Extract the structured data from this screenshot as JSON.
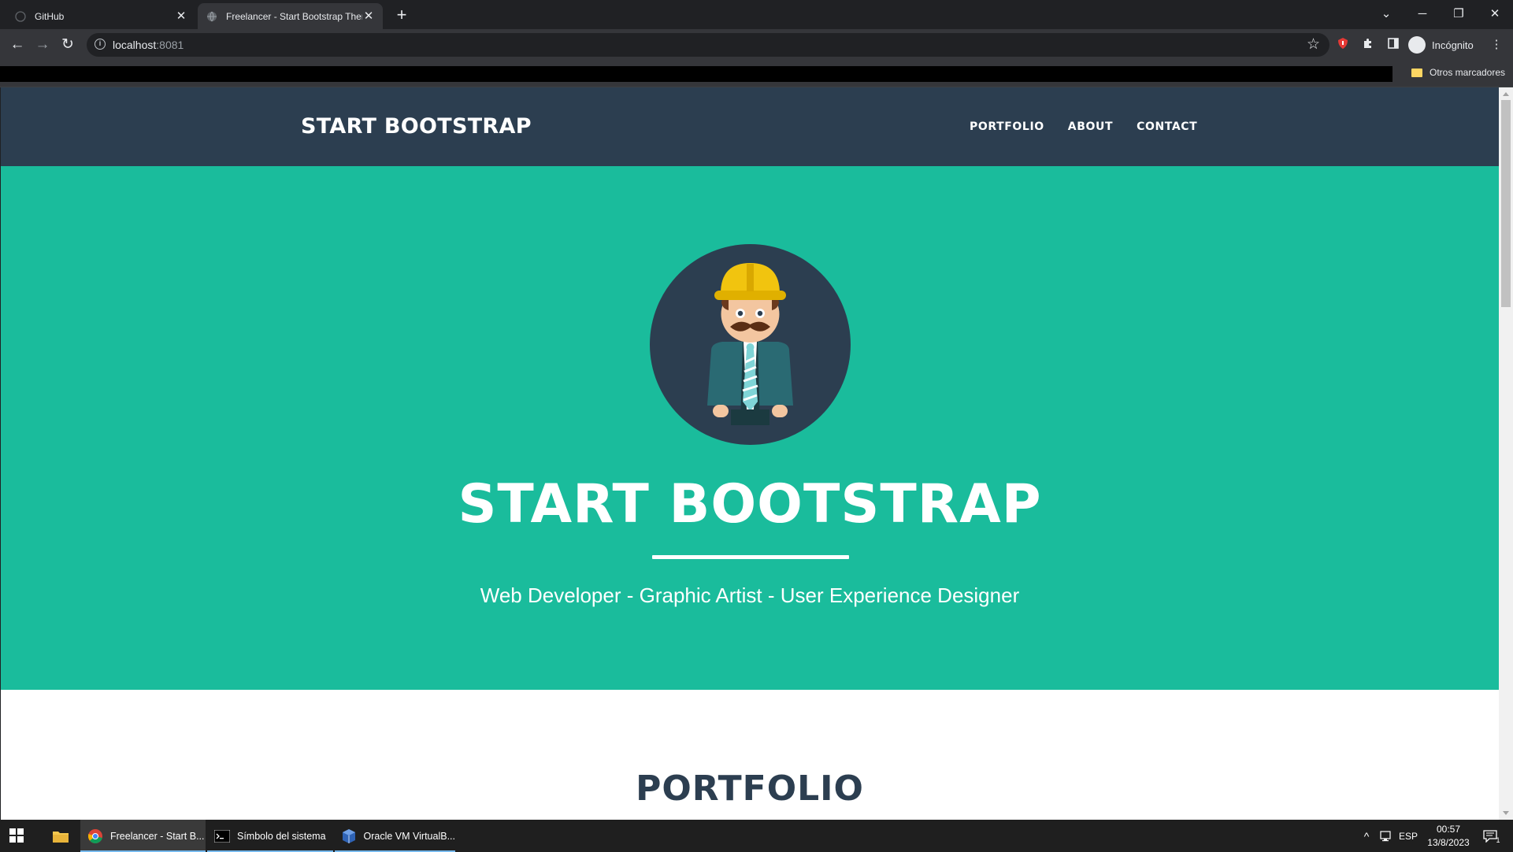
{
  "browser": {
    "tabs": [
      {
        "title": "GitHub",
        "active": false
      },
      {
        "title": "Freelancer - Start Bootstrap Theme",
        "active": true
      }
    ],
    "address": {
      "host": "localhost",
      "port": ":8081"
    },
    "profile_label": "Incógnito",
    "bookmarks_other": "Otros marcadores"
  },
  "site": {
    "brand": "START BOOTSTRAP",
    "nav": [
      "PORTFOLIO",
      "ABOUT",
      "CONTACT"
    ],
    "hero": {
      "title": "START BOOTSTRAP",
      "subtitle": "Web Developer - Graphic Artist - User Experience Designer"
    },
    "portfolio_heading": "PORTFOLIO"
  },
  "colors": {
    "navbar": "#2c3e50",
    "masthead": "#1abc9c",
    "heading_dark": "#2c3e50"
  },
  "taskbar": {
    "apps": [
      {
        "label": "Freelancer - Start B...",
        "icon": "chrome-icon",
        "active": true
      },
      {
        "label": "Símbolo del sistema",
        "icon": "terminal-icon",
        "active": false
      },
      {
        "label": "Oracle VM VirtualB...",
        "icon": "virtualbox-icon",
        "active": false
      }
    ],
    "language": "ESP",
    "time": "00:57",
    "date": "13/8/2023",
    "notification_count": "1"
  }
}
